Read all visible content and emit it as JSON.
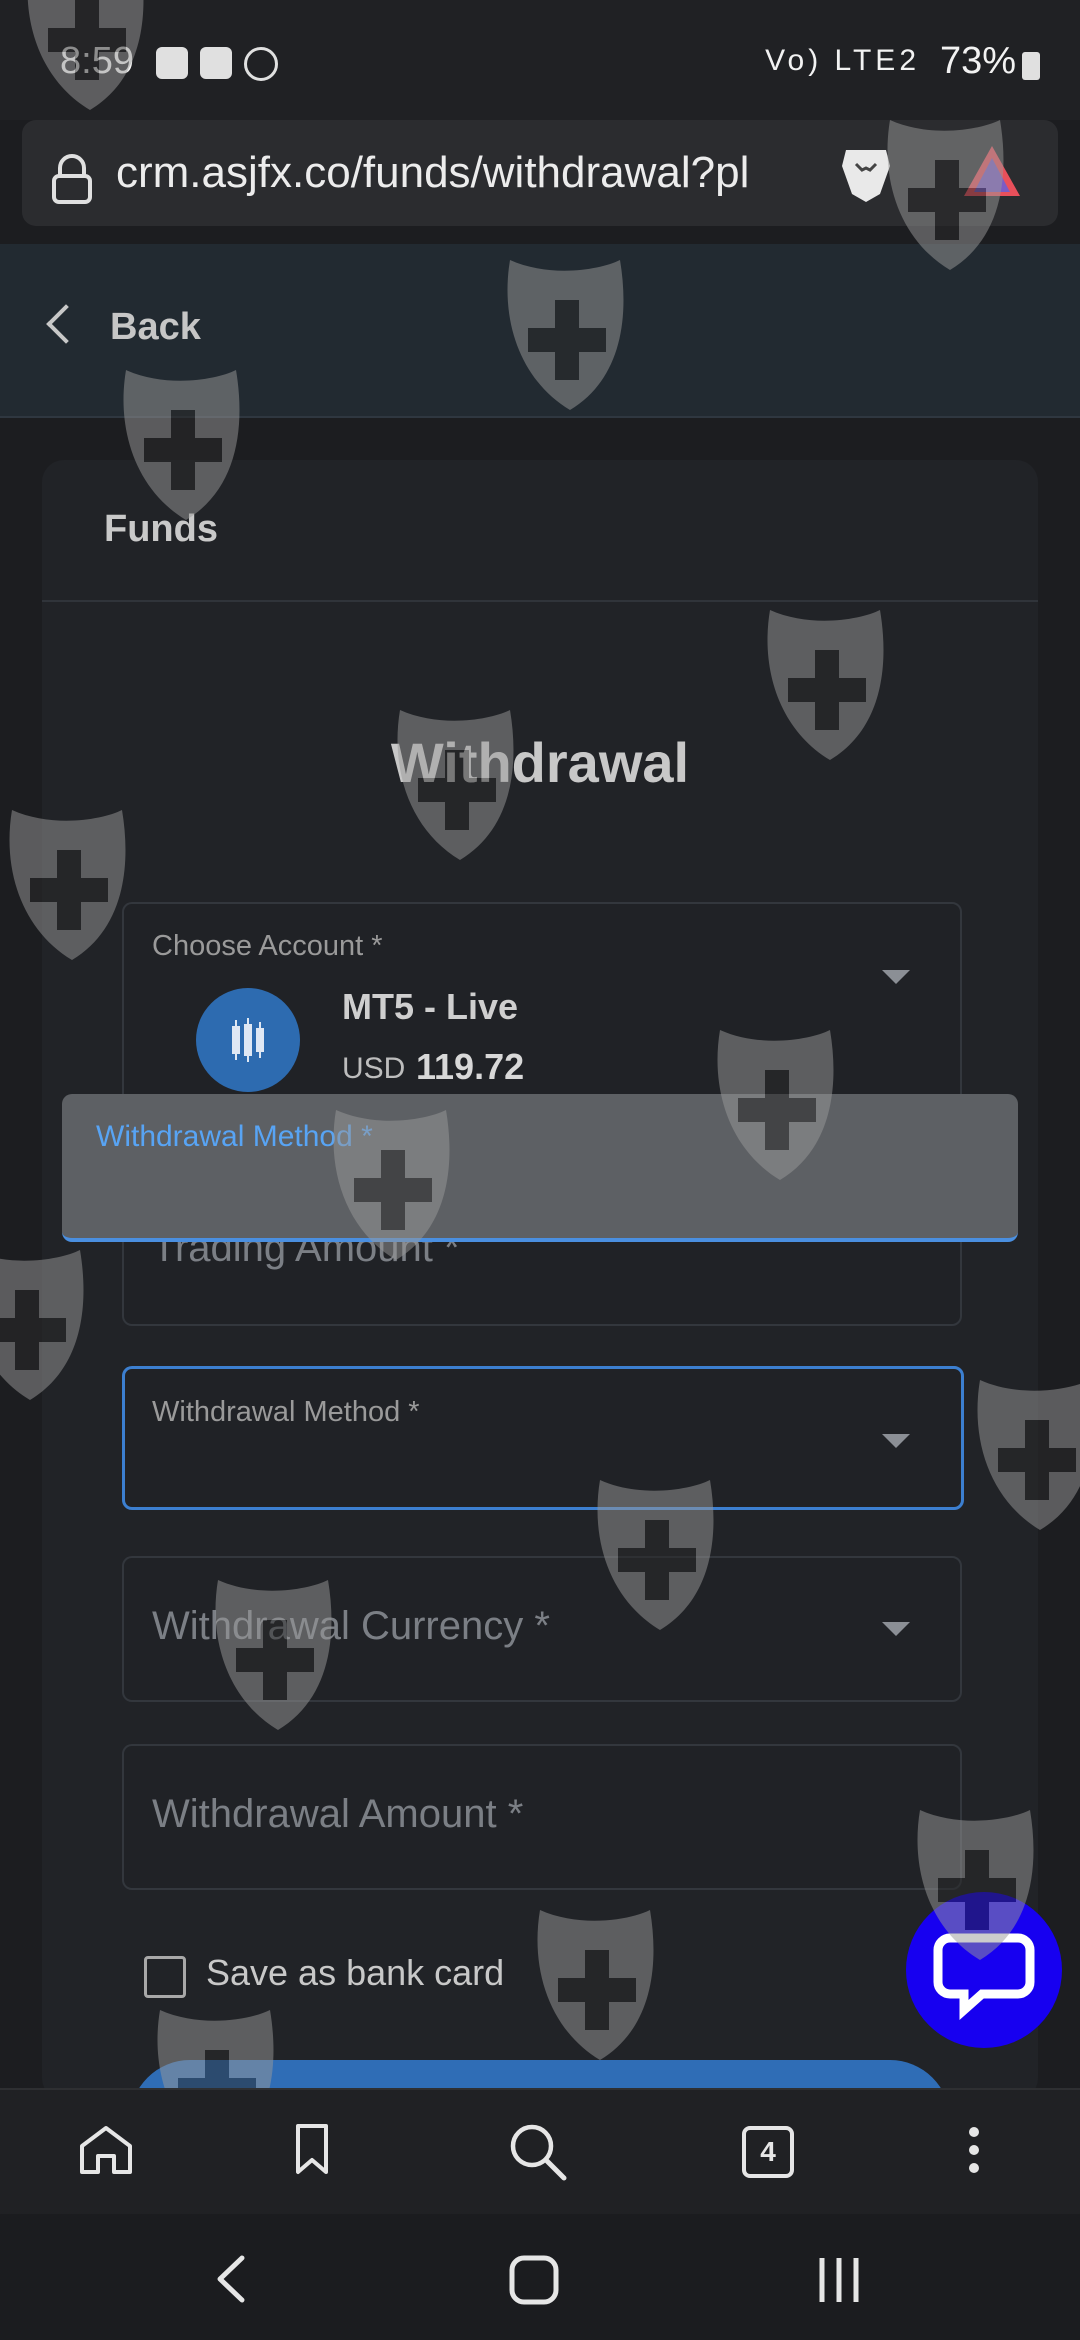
{
  "status_bar": {
    "time": "8:59",
    "battery": "73%",
    "icons": [
      "gallery-icon",
      "check-icon",
      "b-icon",
      "wifi-icon",
      "call-icon",
      "signal-icon",
      "volte-icon",
      "battery-icon"
    ],
    "signal_text": "Vo) LTE2"
  },
  "browser": {
    "url": "crm.asjfx.co/funds/withdrawal?pl",
    "tabs_count": "4",
    "icons": [
      "lock-icon",
      "brave-lion-icon",
      "brave-rewards-icon"
    ]
  },
  "page": {
    "back_label": "Back",
    "card_title": "Funds",
    "heading": "Withdrawal"
  },
  "form": {
    "account": {
      "label": "Choose Account *",
      "name": "MT5 - Live",
      "currency": "USD",
      "balance": "119.72"
    },
    "popup": {
      "label": "Withdrawal Method *"
    },
    "trading_amount": {
      "placeholder": "Trading Amount *"
    },
    "withdrawal_method": {
      "label": "Withdrawal Method *"
    },
    "withdrawal_currency": {
      "placeholder": "Withdrawal Currency *"
    },
    "withdrawal_amount": {
      "placeholder": "Withdrawal Amount *"
    },
    "save_card": {
      "label": "Save as bank card",
      "checked": false
    }
  },
  "colors": {
    "accent": "#3c7fd0",
    "popup_label": "#58a4f4",
    "chat_fab": "#1700f0",
    "account_icon_bg": "#2d6bb0"
  }
}
